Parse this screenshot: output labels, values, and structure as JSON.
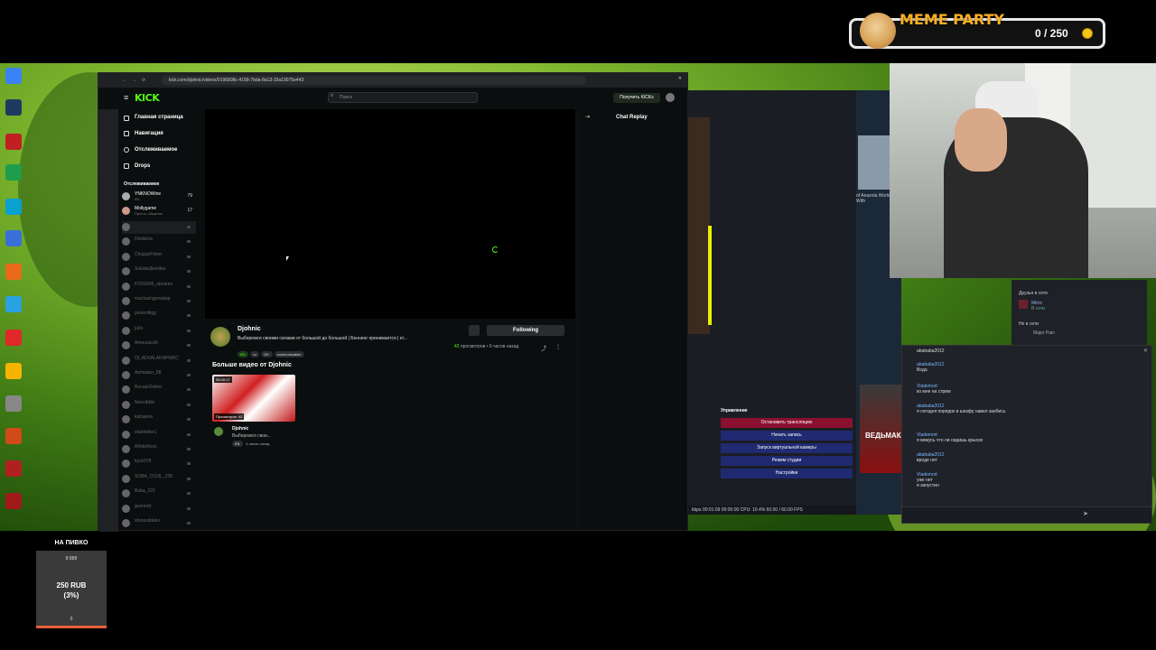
{
  "meme_party": {
    "title": "MEME PARTY",
    "count": "0 / 250"
  },
  "donation": {
    "title": "НА ПИВКО",
    "goal": "8 888",
    "amount": "250 RUB",
    "percent": "(3%)",
    "start": "0"
  },
  "browser": {
    "url": "kick.com/djohnic/videos/0196808c-4158-7bda-8a13-33a19075e443",
    "search_placeholder": "Поиск",
    "get_kicks": "Получить KICKs",
    "logo": "KICK",
    "menu": [
      {
        "label": "Главная страница"
      },
      {
        "label": "Навигация"
      },
      {
        "label": "Отслеживаемое"
      },
      {
        "label": "Drops"
      }
    ],
    "following_header": "Отслеживаемое",
    "channels_live": [
      {
        "name": "YNKNOWine",
        "sub": "IRL",
        "count": "79"
      },
      {
        "name": "Mollygame",
        "sub": "Просто общение",
        "count": "17"
      }
    ],
    "channels_offline": [
      "",
      "Dirtdelva",
      "ChoppyPoker",
      "Sobaka$emikla",
      "FOX1806_streams",
      "mactusingersatup",
      "poisontilgg",
      "ju0s",
      "Amousacxh",
      "Ol_ADVALAKAPWKC",
      "Azmadan_88",
      "RocaleOnline",
      "Nonsibble",
      "kaltujeka",
      "stablebler1",
      "Whitehloss",
      "kyck378",
      "SOBA_COJIL_228",
      "Boba_222",
      "gusnnrd",
      "stonesdokko"
    ],
    "chat_title": "Chat Replay",
    "streamer": "Djohnic",
    "stream_title": "Выберемся своими силами от большой до большой | Беннинг принимается | кт...",
    "tags": [
      "IRL",
      "ru",
      "18+",
      "communication"
    ],
    "follow": "Following",
    "views_count": "42",
    "views_label": "просмотров",
    "ago": "6 часов назад",
    "more_videos": "Больше видео от Djohnic",
    "video": {
      "duration": "05:40:17",
      "views": "Просмотров: 42",
      "channel": "Djohnic",
      "title": "Выберемся свои...",
      "tag": "IRL",
      "ago": "6 часов назад"
    }
  },
  "obs": {
    "controls_title": "Управление",
    "buttons": [
      "Остановить трансляцию",
      "Начать запись",
      "Запуск виртуальной камеры",
      "Режим студии",
      "Настройки"
    ],
    "status": "kbps    00:01:09    00:00:00    CPU: 10.4%    60.00 / 60.00 FPS"
  },
  "steam": {
    "game_text": "of Anazola World With"
  },
  "friends": {
    "online_header": "Друзья в сети",
    "friend": "Mitrix",
    "friend_status": "В сети",
    "not_online": "Не в сети",
    "other": "Major Pain"
  },
  "chat_dialog": {
    "title": "abababa2012",
    "messages": [
      {
        "name": "abababa2012",
        "text": "Вода"
      },
      {
        "name": "Vlademort",
        "text": "ко мне на стрим"
      },
      {
        "name": "abababa2012",
        "text": "я сегодня порядок в шкафу навел заебись"
      },
      {
        "name": "Vlademort",
        "text": "я вижусь что ли сидишь крысих"
      },
      {
        "name": "abababa2012",
        "text": "вроде нет"
      },
      {
        "name": "Vlademort",
        "text": "уже нет\nя запустил"
      }
    ]
  },
  "witcher_text": "ВЕДЬМАК"
}
